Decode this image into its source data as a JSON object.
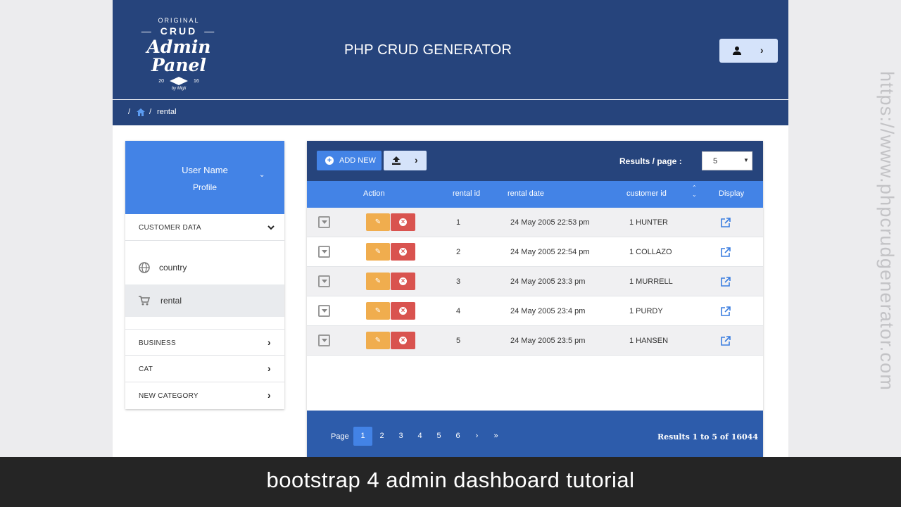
{
  "logo": {
    "top": "ORIGINAL",
    "crud": "CRUD",
    "main": "Admin Panel",
    "year_left": "20",
    "year_right": "16",
    "by": "by Migli"
  },
  "header": {
    "title": "PHP CRUD GENERATOR",
    "user_icon": "user-icon",
    "chevron": "›"
  },
  "breadcrumb": {
    "sep": "/",
    "home_icon": "home-icon",
    "current": "rental"
  },
  "sidebar": {
    "profile": {
      "name": "User Name",
      "sub": "Profile",
      "chevron": "⌄"
    },
    "categories": [
      {
        "label": "CUSTOMER DATA",
        "arrow": "⌄"
      },
      {
        "label": "BUSINESS",
        "arrow": "›"
      },
      {
        "label": "CAT",
        "arrow": "›"
      },
      {
        "label": "NEW CATEGORY",
        "arrow": "›"
      }
    ],
    "items": [
      {
        "label": "country",
        "icon": "globe-icon",
        "active": false
      },
      {
        "label": "rental",
        "icon": "cart-icon",
        "active": true
      }
    ]
  },
  "toolbar": {
    "add_label": "ADD NEW",
    "results_label": "Results / page :",
    "results_value": "5"
  },
  "table": {
    "headers": {
      "action": "Action",
      "rental_id": "rental id",
      "rental_date": "rental date",
      "customer_id": "customer id",
      "display": "Display"
    },
    "rows": [
      {
        "id": "1",
        "date": "24 May 2005 22:53 pm",
        "customer": "1 HUNTER"
      },
      {
        "id": "2",
        "date": "24 May 2005 22:54 pm",
        "customer": "1 COLLAZO"
      },
      {
        "id": "3",
        "date": "24 May 2005 23:3 pm",
        "customer": "1 MURRELL"
      },
      {
        "id": "4",
        "date": "24 May 2005 23:4 pm",
        "customer": "1 PURDY"
      },
      {
        "id": "5",
        "date": "24 May 2005 23:5 pm",
        "customer": "1 HANSEN"
      }
    ]
  },
  "pager": {
    "label": "Page",
    "pages": [
      "1",
      "2",
      "3",
      "4",
      "5",
      "6"
    ],
    "active": "1",
    "next": "›",
    "last": "»",
    "results": "Results 1 to 5 of 16044"
  },
  "caption": "bootstrap 4 admin dashboard tutorial",
  "watermark": "https://www.phpcrudgenerator.com",
  "colors": {
    "header": "#26447c",
    "accent": "#4383e6",
    "pager": "#2d5cab",
    "edit": "#f0ad4e",
    "delete": "#d9534f"
  }
}
